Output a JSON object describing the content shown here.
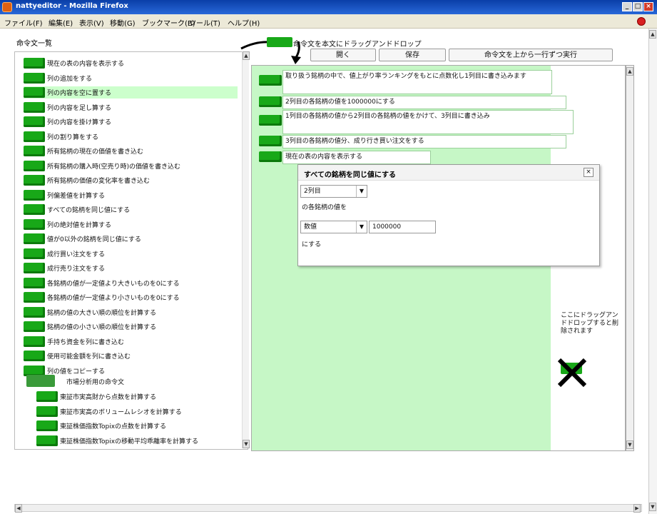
{
  "window": {
    "title": "nattyeditor - Mozilla Firefox",
    "minimize": "_",
    "maximize": "□",
    "close": "×"
  },
  "menubar": [
    {
      "label": "ファイル(F)"
    },
    {
      "label": "編集(E)"
    },
    {
      "label": "表示(V)"
    },
    {
      "label": "移動(G)"
    },
    {
      "label": "ブックマーク(B)"
    },
    {
      "label": "ツール(T)"
    },
    {
      "label": "ヘルプ(H)"
    }
  ],
  "left_panel": {
    "title": "命令文一覧",
    "items": [
      {
        "label": "現在の表の内容を表示する",
        "selected": false,
        "indent": 0
      },
      {
        "label": "列の追加をする",
        "selected": false,
        "indent": 0
      },
      {
        "label": "列の内容を空に置する",
        "selected": true,
        "indent": 0
      },
      {
        "label": "列の内容を足し算する",
        "selected": false,
        "indent": 0
      },
      {
        "label": "列の内容を掛け算する",
        "selected": false,
        "indent": 0
      },
      {
        "label": "列の割り算をする",
        "selected": false,
        "indent": 0
      },
      {
        "label": "所有銘柄の現在の価値を書き込む",
        "selected": false,
        "indent": 0
      },
      {
        "label": "所有銘柄の購入時(空売り時)の価値を書き込む",
        "selected": false,
        "indent": 0
      },
      {
        "label": "所有銘柄の価値の変化率を書き込む",
        "selected": false,
        "indent": 0
      },
      {
        "label": "列偏差値を計算する",
        "selected": false,
        "indent": 0
      },
      {
        "label": "すべての銘柄を同じ値にする",
        "selected": false,
        "indent": 0
      },
      {
        "label": "列の絶対値を計算する",
        "selected": false,
        "indent": 0
      },
      {
        "label": "値が0以外の銘柄を同じ値にする",
        "selected": false,
        "indent": 0
      },
      {
        "label": "成行買い注文をする",
        "selected": false,
        "indent": 0
      },
      {
        "label": "成行売り注文をする",
        "selected": false,
        "indent": 0
      },
      {
        "label": "各銘柄の値が一定値より大きいものを0にする",
        "selected": false,
        "indent": 0
      },
      {
        "label": "各銘柄の値が一定値より小さいものを0にする",
        "selected": false,
        "indent": 0
      },
      {
        "label": "銘柄の値の大きい順の順位を計算する",
        "selected": false,
        "indent": 0
      },
      {
        "label": "銘柄の値の小さい順の順位を計算する",
        "selected": false,
        "indent": 0
      },
      {
        "label": "手持ち資金を列に書き込む",
        "selected": false,
        "indent": 0
      },
      {
        "label": "使用可能金額を列に書き込む",
        "selected": false,
        "indent": 0
      },
      {
        "label": "列の値をコピーする",
        "selected": false,
        "indent": 0
      }
    ],
    "group_label": "市場分析用の命令文",
    "group_items": [
      {
        "label": "東証市実高財から点数を計算する"
      },
      {
        "label": "東証市実高のボリュームレシオを計算する"
      },
      {
        "label": "東証株価指数Topixの点数を計算する"
      },
      {
        "label": "東証株価指数Topixの移動平均乖離率を計算する"
      }
    ]
  },
  "toolbar": {
    "drag_hint": "命令文を本文にドラッグアンドドロップ",
    "open_label": "開く",
    "save_label": "保存",
    "run_label": "命令文を上から一行ずつ実行"
  },
  "program": [
    {
      "label": "取り扱う銘柄の中で、値上がり率ランキングをもとに点数化し1列目に書き込みます",
      "tall": true
    },
    {
      "label": "2列目の各銘柄の値を1000000にする",
      "tall": false
    },
    {
      "label": "1列目の各銘柄の値から2列目の各銘柄の値をかけて、3列目に書き込み",
      "tall": true
    },
    {
      "label": "3列目の各銘柄の値分、成り行き買い注文をする",
      "tall": false
    },
    {
      "label": "現在の表の内容を表示する",
      "tall": false
    }
  ],
  "dialog": {
    "title": "すべての銘柄を同じ値にする",
    "close": "×",
    "column_select": "2列目",
    "text1": "の各銘柄の値を",
    "type_select": "数値",
    "value": "1000000",
    "text2": "にする"
  },
  "trash": {
    "text": "ここにドラッグアンドドロップすると削除されます"
  },
  "colors": {
    "block_green": "#18a818",
    "workspace_green": "#c6f7c6",
    "selected_row": "#ccffcc"
  }
}
